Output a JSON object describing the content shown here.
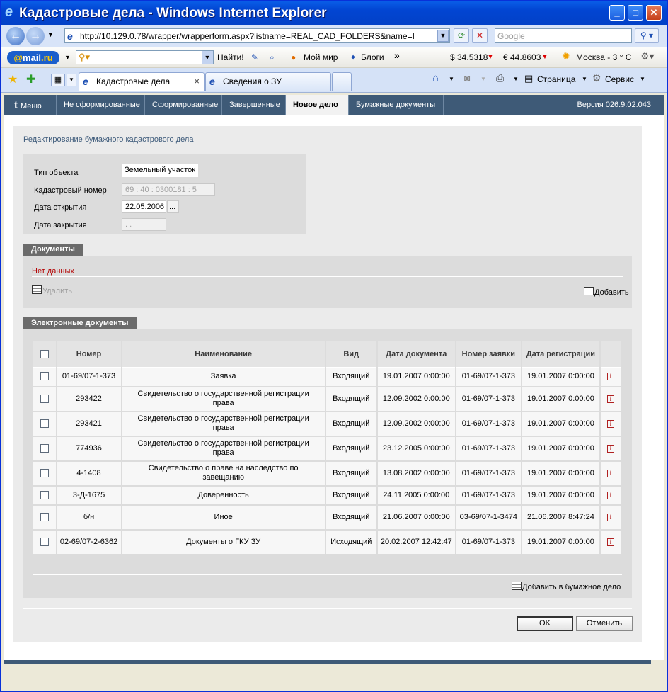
{
  "window": {
    "title": "Кадастровые дела - Windows Internet Explorer"
  },
  "address": {
    "url": "http://10.129.0.78/wrapper/wrapperform.aspx?listname=REAL_CAD_FOLDERS&name=I",
    "search_placeholder": "Google"
  },
  "mailbar": {
    "logo_at": "@",
    "logo_mail": "mail",
    "logo_ru": ".ru",
    "search_button": "Найти!",
    "moi_mir": "Мой мир",
    "blogs": "Блоги",
    "more": "»",
    "usd": "$ 34.5318",
    "eur": "€ 44.8603",
    "weather": "Москва  - 3 ° C"
  },
  "ietabs": [
    {
      "label": "Кадастровые дела",
      "close": "×"
    },
    {
      "label": "Сведения о ЗУ"
    }
  ],
  "ietools": {
    "page": "Страница",
    "service": "Сервис"
  },
  "appnav": {
    "menu": "Меню",
    "items": [
      "Не сформированные",
      "Сформированные",
      "Завершенные",
      "Новое дело",
      "Бумажные документы"
    ],
    "version": "Версия 026.9.02.043"
  },
  "form": {
    "heading": "Редактирование бумажного кадастрового дела",
    "object_type_label": "Тип объекта",
    "object_type_value": "Земельный участок",
    "cad_number_label": "Кадастровый номер",
    "cad_number_value": "69 : 40 : 0300181  : 5",
    "open_date_label": "Дата открытия",
    "open_date_value": "22.05.2006",
    "date_picker": "...",
    "close_date_label": "Дата закрытия",
    "close_date_value": "  .   ."
  },
  "documents": {
    "title": "Документы",
    "no_data": "Нет данных",
    "delete": "Удалить",
    "add": "Добавить"
  },
  "edocs": {
    "title": "Электронные документы",
    "columns": [
      "Номер",
      "Наименование",
      "Вид",
      "Дата документа",
      "Номер заявки",
      "Дата регистрации"
    ],
    "rows": [
      {
        "num": "01-69/07-1-373",
        "name": "Заявка",
        "kind": "Входящий",
        "doc_date": "19.01.2007 0:00:00",
        "req": "01-69/07-1-373",
        "reg": "19.01.2007 0:00:00"
      },
      {
        "num": "293422",
        "name": "Свидетельство о государственной регистрации права",
        "kind": "Входящий",
        "doc_date": "12.09.2002 0:00:00",
        "req": "01-69/07-1-373",
        "reg": "19.01.2007 0:00:00"
      },
      {
        "num": "293421",
        "name": "Свидетельство о государственной регистрации права",
        "kind": "Входящий",
        "doc_date": "12.09.2002 0:00:00",
        "req": "01-69/07-1-373",
        "reg": "19.01.2007 0:00:00"
      },
      {
        "num": "774936",
        "name": "Свидетельство о государственной регистрации права",
        "kind": "Входящий",
        "doc_date": "23.12.2005 0:00:00",
        "req": "01-69/07-1-373",
        "reg": "19.01.2007 0:00:00"
      },
      {
        "num": "4-1408",
        "name": "Свидетельство о праве на наследство по завещанию",
        "kind": "Входящий",
        "doc_date": "13.08.2002 0:00:00",
        "req": "01-69/07-1-373",
        "reg": "19.01.2007 0:00:00"
      },
      {
        "num": "3-Д-1675",
        "name": "Доверенность",
        "kind": "Входящий",
        "doc_date": "24.11.2005 0:00:00",
        "req": "01-69/07-1-373",
        "reg": "19.01.2007 0:00:00"
      },
      {
        "num": "б/н",
        "name": "Иное",
        "kind": "Входящий",
        "doc_date": "21.06.2007 0:00:00",
        "req": "03-69/07-1-3474",
        "reg": "21.06.2007 8:47:24"
      },
      {
        "num": "02-69/07-2-6362",
        "name": "Документы о ГКУ ЗУ",
        "kind": "Исходящий",
        "doc_date": "20.02.2007 12:42:47",
        "req": "01-69/07-1-373",
        "reg": "19.01.2007 0:00:00"
      }
    ],
    "info_glyph": "i",
    "add_to_paper": "Добавить в бумажное дело"
  },
  "buttons": {
    "ok": "OK",
    "cancel": "Отменить"
  }
}
